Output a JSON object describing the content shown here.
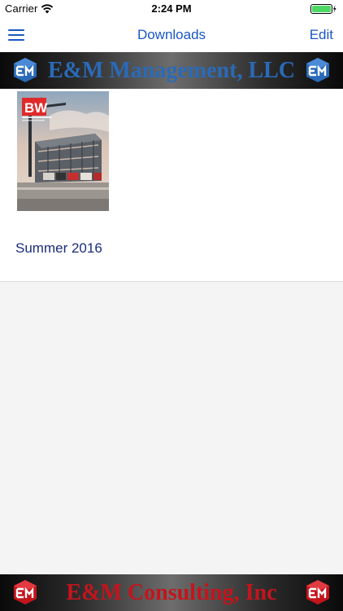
{
  "status_bar": {
    "carrier": "Carrier",
    "time": "2:24 PM"
  },
  "nav": {
    "title": "Downloads",
    "edit_label": "Edit",
    "menu_icon": "hamburger-menu-icon"
  },
  "banner_top": {
    "text": "E&M Management, LLC",
    "color": "#2a6ab8"
  },
  "banner_bottom": {
    "text": "E&M Consulting, Inc",
    "color": "#c4141c"
  },
  "downloads": [
    {
      "title": "Summer 2016",
      "cover": {
        "logo": "BW",
        "subtitle": "BUILDING WASHINGTON",
        "accent": "#e02a2a"
      }
    }
  ],
  "colors": {
    "tint": "#1a56c4",
    "item_text": "#1a2d7a",
    "background": "#f4f4f4"
  }
}
